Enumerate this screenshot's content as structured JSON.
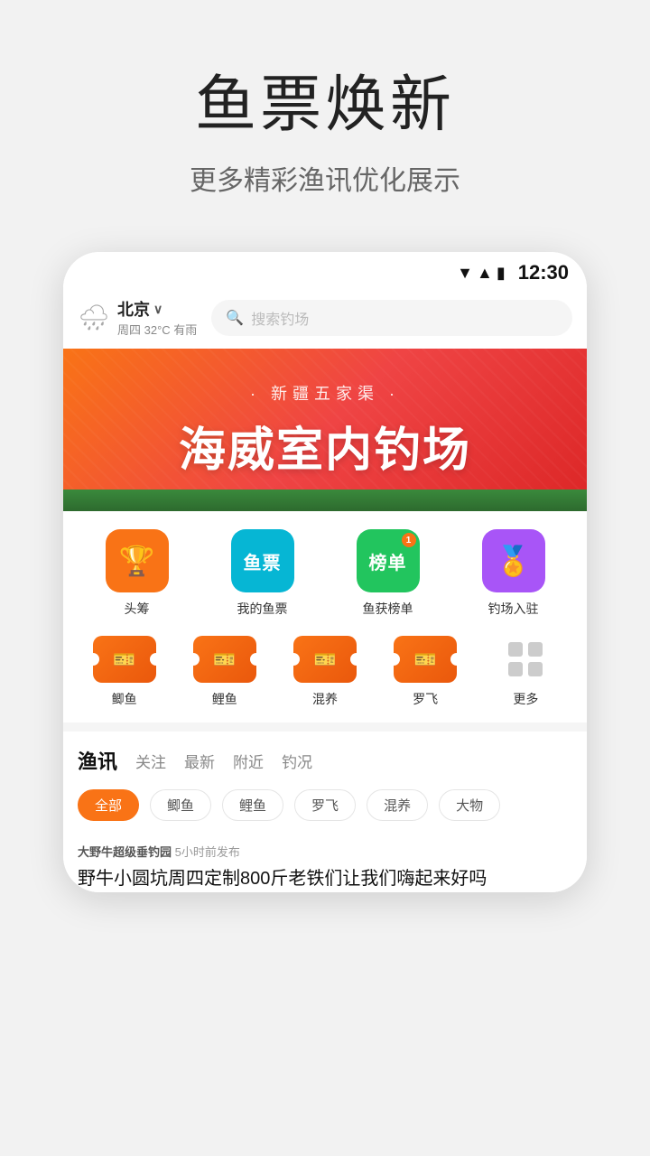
{
  "page": {
    "bg_color": "#f2f2f2"
  },
  "top": {
    "main_title": "鱼票焕新",
    "sub_title": "更多精彩渔讯优化展示"
  },
  "status_bar": {
    "time": "12:30"
  },
  "header": {
    "city": "北京",
    "weather": "周四  32°C  有雨",
    "search_placeholder": "搜索钓场"
  },
  "banner": {
    "subtitle": "· 新疆五家渠 ·",
    "title": "海威室内钓场"
  },
  "quick_icons": [
    {
      "id": "touzhu",
      "label": "头筹",
      "color": "orange",
      "icon": "🏆"
    },
    {
      "id": "yupiao",
      "label": "我的鱼票",
      "color": "cyan",
      "text": "鱼票"
    },
    {
      "id": "bangdan",
      "label": "鱼获榜单",
      "color": "green",
      "text": "榜单"
    },
    {
      "id": "ruzhu",
      "label": "钓场入驻",
      "color": "purple",
      "icon": "🏅"
    }
  ],
  "categories": [
    {
      "id": "liyu",
      "label": "鲫鱼"
    },
    {
      "id": "liyu2",
      "label": "鲤鱼"
    },
    {
      "id": "hunyang",
      "label": "混养"
    },
    {
      "id": "luofei",
      "label": "罗飞"
    },
    {
      "id": "more",
      "label": "更多"
    }
  ],
  "news": {
    "main_tab": "渔讯",
    "tabs": [
      "关注",
      "最新",
      "附近",
      "钓况"
    ],
    "filters": [
      {
        "label": "全部",
        "active": true
      },
      {
        "label": "鲫鱼",
        "active": false
      },
      {
        "label": "鲤鱼",
        "active": false
      },
      {
        "label": "罗飞",
        "active": false
      },
      {
        "label": "混养",
        "active": false
      },
      {
        "label": "大物",
        "active": false
      }
    ],
    "card": {
      "source": "大野牛超级垂钓园",
      "time": "5小时前发布",
      "title": "野牛小圆坑周四定制800斤老铁们让我们嗨起来好吗"
    }
  }
}
